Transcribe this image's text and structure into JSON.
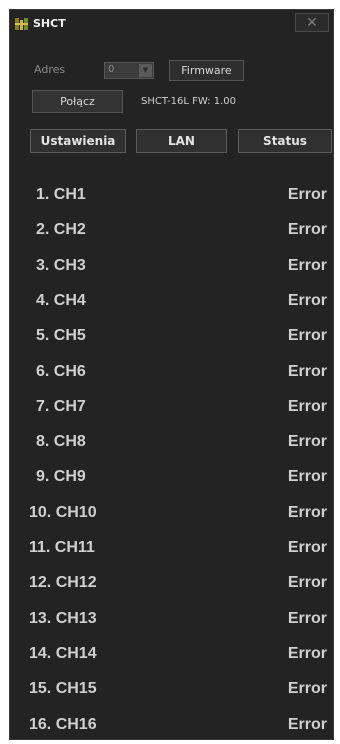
{
  "window": {
    "title": "SHCT",
    "close_label": "✕",
    "icon": "shct-logo-icon"
  },
  "connection": {
    "adres_label": "Adres",
    "adres_value": "0",
    "firmware_button": "Firmware",
    "connect_button": "Połącz",
    "device_info": "SHCT-16L  FW: 1.00"
  },
  "tabs": [
    {
      "label": "Ustawienia"
    },
    {
      "label": "LAN"
    },
    {
      "label": "Status"
    }
  ],
  "channels": [
    {
      "name": "1. CH1",
      "status": "Error"
    },
    {
      "name": "2. CH2",
      "status": "Error"
    },
    {
      "name": "3. CH3",
      "status": "Error"
    },
    {
      "name": "4. CH4",
      "status": "Error"
    },
    {
      "name": "5. CH5",
      "status": "Error"
    },
    {
      "name": "6. CH6",
      "status": "Error"
    },
    {
      "name": "7. CH7",
      "status": "Error"
    },
    {
      "name": "8. CH8",
      "status": "Error"
    },
    {
      "name": "9. CH9",
      "status": "Error"
    },
    {
      "name": "10. CH10",
      "status": "Error"
    },
    {
      "name": "11. CH11",
      "status": "Error"
    },
    {
      "name": "12. CH12",
      "status": "Error"
    },
    {
      "name": "13. CH13",
      "status": "Error"
    },
    {
      "name": "14. CH14",
      "status": "Error"
    },
    {
      "name": "15. CH15",
      "status": "Error"
    },
    {
      "name": "16. CH16",
      "status": "Error"
    }
  ]
}
